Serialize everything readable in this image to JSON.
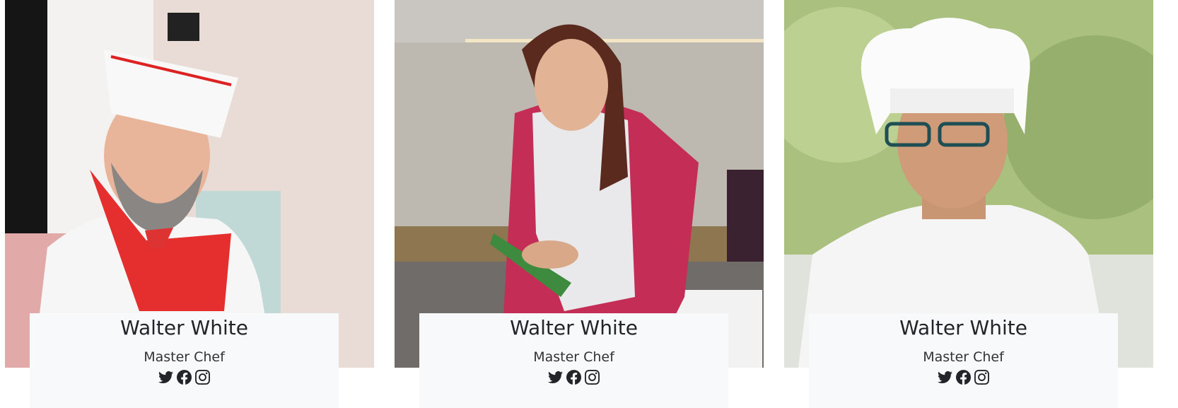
{
  "team": [
    {
      "name": "Walter White",
      "role": "Master Chef",
      "photo_alt": "chef-with-paper-hat"
    },
    {
      "name": "Walter White",
      "role": "Master Chef",
      "photo_alt": "pastry-chef-with-piping-bag"
    },
    {
      "name": "Walter White",
      "role": "Master Chef",
      "photo_alt": "chef-with-toque-and-glasses"
    }
  ],
  "social_icons": [
    "twitter-icon",
    "facebook-icon",
    "instagram-icon"
  ],
  "colors": {
    "card_bg": "#f8f9fa",
    "text": "#212529"
  }
}
